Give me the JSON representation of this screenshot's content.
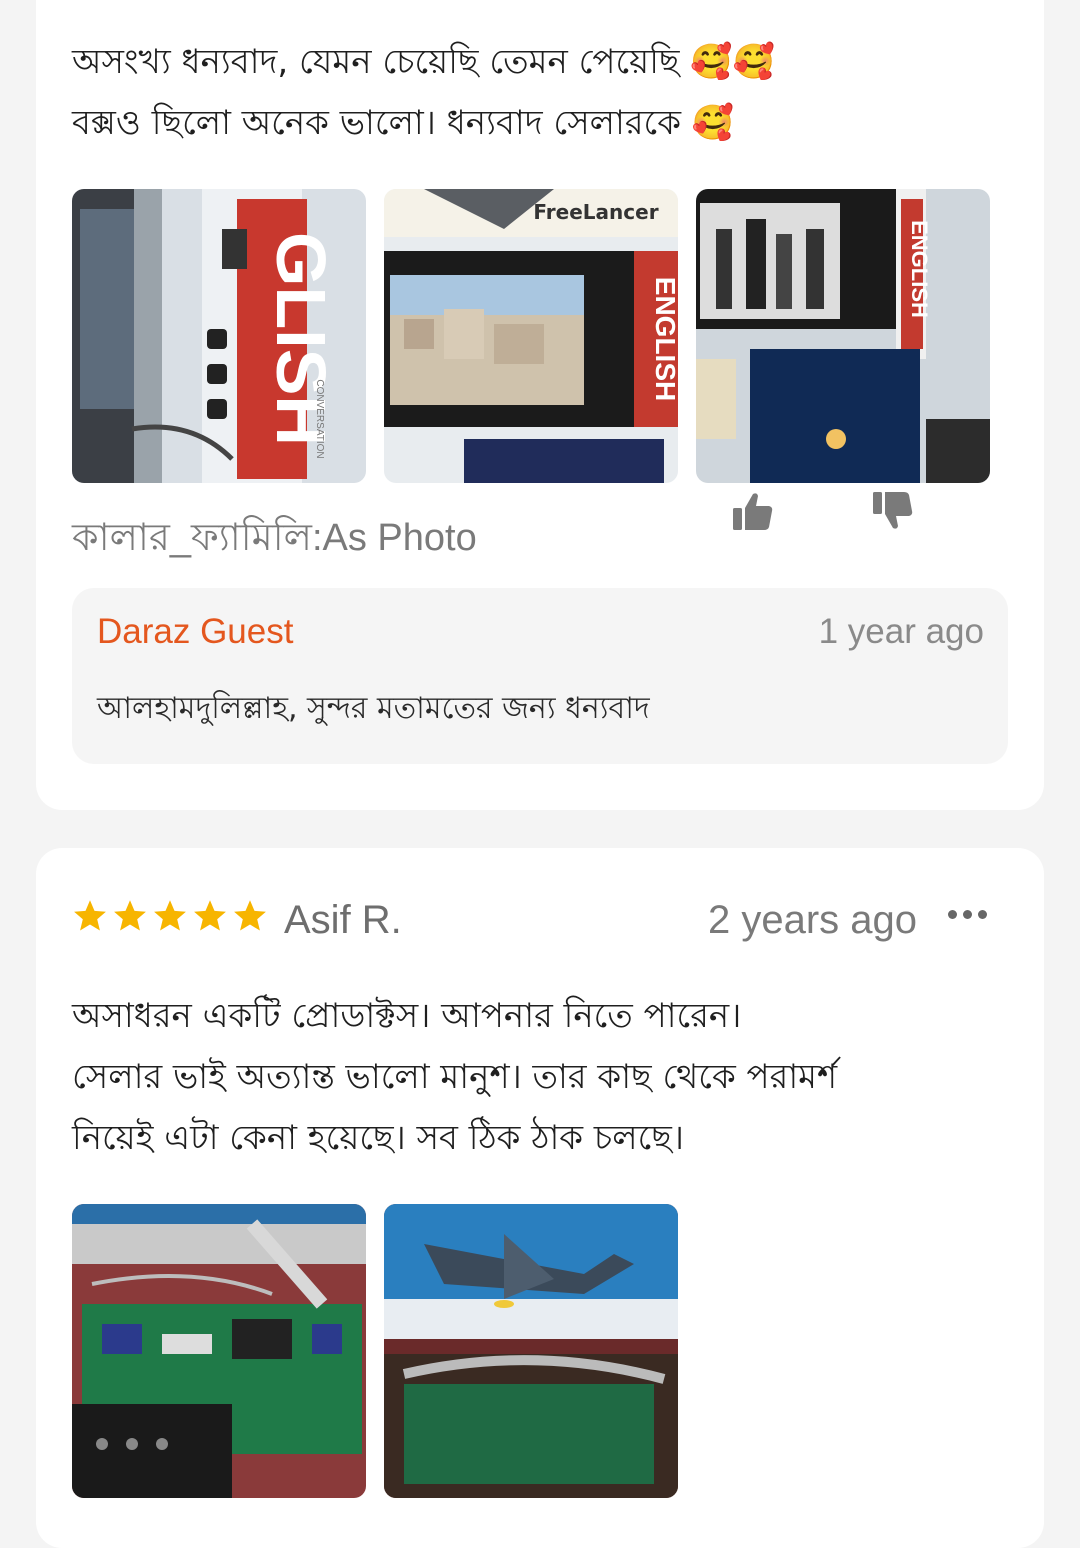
{
  "reviews": [
    {
      "text_lines": [
        "অসংখ্য ধন্যবাদ, যেমন চেয়েছি তেমন পেয়েছি 🥰🥰",
        "বক্সও ছিলো অনেক ভালো। ধন্যবাদ সেলারকে 🥰"
      ],
      "photos": [
        {
          "icon": "tv-board-on-poster-photo",
          "poster_text": "GLISH",
          "small_text": "CONVERSATION"
        },
        {
          "icon": "monitor-city-photo",
          "poster_text": "FreeLancer",
          "side_text": "ENGLISH"
        },
        {
          "icon": "monitor-people-photo",
          "side_text": "ENGLISH"
        }
      ],
      "variant_label": "কালার_ফ্যামিলি:As Photo",
      "reply": {
        "author": "Daraz Guest",
        "time": "1 year ago",
        "text": "আলহামদুলিল্লাহ, সুন্দর মতামতের জন্য ধন্যবাদ"
      }
    },
    {
      "rating": 5,
      "reviewer": "Asif R.",
      "time": "2 years ago",
      "text_lines": [
        "অসাধরন একটি প্রোডাক্টস। আপনার নিতে পারেন।",
        "সেলার ভাই অত্যান্ত ভালো মানুশ। তার কাছ থেকে পরামর্শ",
        "নিয়েই এটা কেনা হয়েছে। সব ঠিক ঠাক চলছে।"
      ],
      "photos": [
        {
          "icon": "circuit-board-photo"
        },
        {
          "icon": "monitor-airplane-photo"
        }
      ]
    }
  ],
  "colors": {
    "accent": "#e4571e",
    "star": "#f7b500"
  }
}
